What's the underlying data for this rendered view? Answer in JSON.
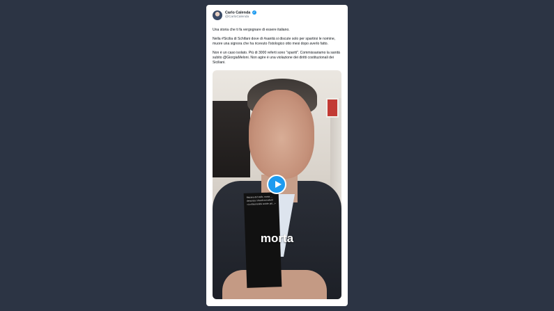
{
  "tweet": {
    "author_name": "Carlo Calenda",
    "author_handle": "@CarloCalenda",
    "verified": true,
    "paragraphs": [
      "Una storia che ti fa vergognare di essere italiano.",
      "Nella #Sicilia di Schifani dove di #sanità si discute solo per spartirsi le nomine, muore una signora che ha ricevuto l'istologico otto mesi dopo averlo fatto.",
      "Non è un caso isolato. Più di 3000 referti sono \"spariti\". Commissariamo la sanità subito @GiorgiaMeloni. Non agire è una violazione dei diritti costituzionali dei Siciliani."
    ]
  },
  "video": {
    "caption_overlay": "morta",
    "phone_screen_lines": [
      "Mazara del Vallo, morta ...",
      "denuncia i ritardi nei referti",
      "«La disumanità uccide più...»"
    ],
    "play_icon": "play-icon"
  },
  "colors": {
    "page_background": "#2c3444",
    "card": "#ffffff",
    "accent": "#1d9bf0"
  }
}
